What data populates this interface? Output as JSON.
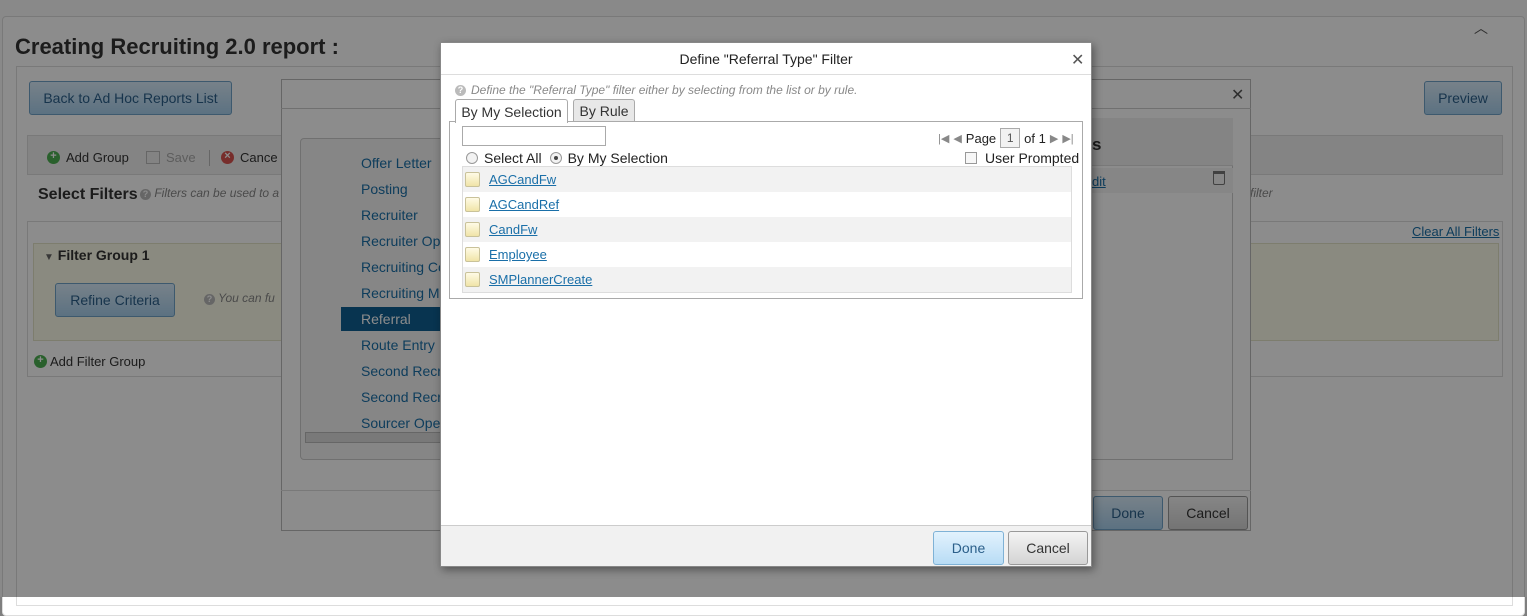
{
  "page": {
    "title": "Creating Recruiting 2.0 report :",
    "back_button": "Back to Ad Hoc Reports List",
    "preview_button": "Preview",
    "toolbar": {
      "add_group": "Add Group",
      "save": "Save",
      "cancel": "Cance"
    },
    "select_filters": "Select Filters",
    "filters_help": "Filters can be used to a",
    "filters_help_tail": "filter",
    "clear_all_filters": "Clear All Filters",
    "filter_group_title": "Filter Group 1",
    "refine_criteria": "Refine Criteria",
    "refine_help": "You can fu",
    "add_filter_group": "Add Filter Group"
  },
  "mid_dialog": {
    "fields": [
      "Offer Letter",
      "Posting",
      "Recruiter",
      "Recruiter Ope",
      "Recruiting Co",
      "Recruiting Ma",
      "Referral",
      "Route Entry",
      "Second Recru",
      "Second Recru",
      "Sourcer Opera"
    ],
    "active_field": "Referral",
    "right_heading": "s",
    "edit_link": "dit",
    "done": "Done",
    "cancel": "Cancel"
  },
  "dialog": {
    "title": "Define \"Referral Type\" Filter",
    "help_text": "Define the \"Referral Type\" filter either by selecting from the list or by rule.",
    "tabs": [
      "By My Selection",
      "By Rule"
    ],
    "search_value": "",
    "pager": {
      "page_label": "Page",
      "page_value": "1",
      "of_label": "of 1"
    },
    "select_all": "Select All",
    "by_my_selection": "By My Selection",
    "user_prompted": "User Prompted",
    "items": [
      "AGCandFw",
      "AGCandRef",
      "CandFw",
      "Employee",
      "SMPlannerCreate"
    ],
    "done": "Done",
    "cancel": "Cancel"
  },
  "colors": {
    "accent": "#0f5f92",
    "link": "#1a6fa8",
    "filter_group_bg": "#fbfbe9"
  },
  "icons": [
    "close-icon",
    "help-icon",
    "first-page-icon",
    "prev-page-icon",
    "next-page-icon",
    "last-page-icon",
    "trash-icon",
    "add-icon",
    "cancel-icon",
    "save-icon",
    "collapse-icon"
  ]
}
